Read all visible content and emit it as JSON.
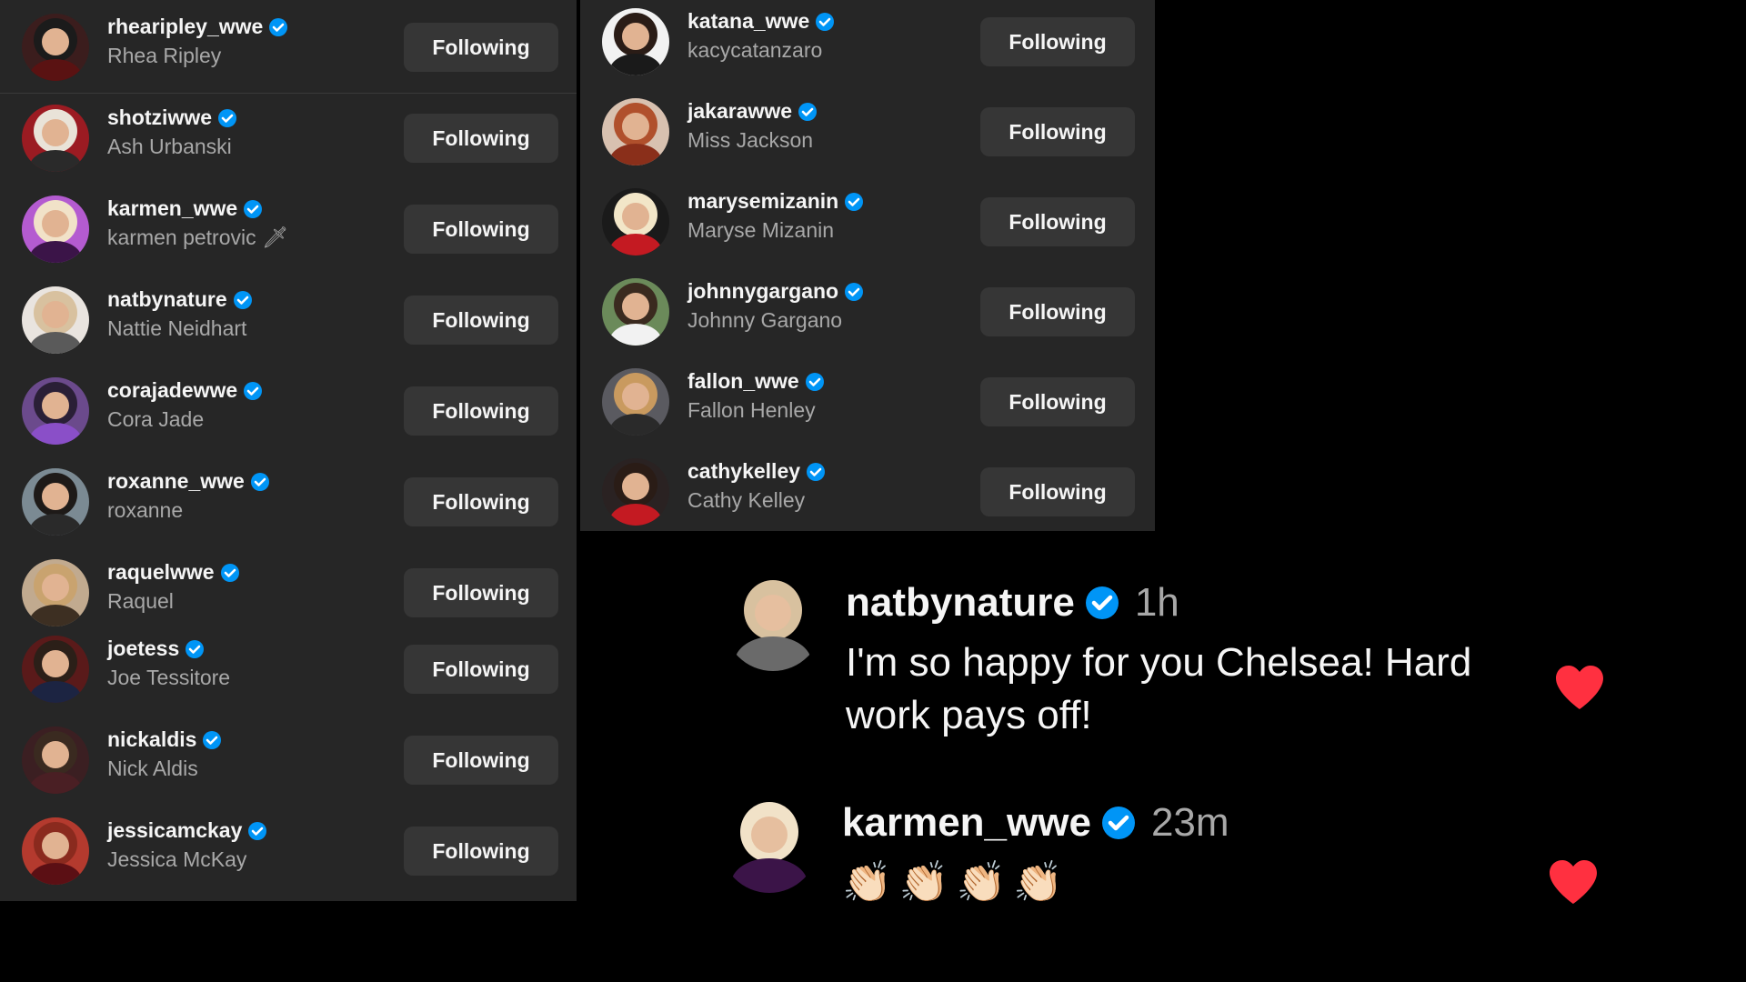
{
  "following_left": [
    {
      "username": "rhearipley_wwe",
      "fullname": "Rhea Ripley",
      "button": "Following",
      "avatar": {
        "hair": "#1b1b1b",
        "bg": "#3b1d1d",
        "body": "#5a1212"
      }
    },
    {
      "username": "shotziwwe",
      "fullname": "Ash Urbanski",
      "button": "Following",
      "avatar": {
        "hair": "#e9e3d8",
        "bg": "#9b1b22",
        "body": "#2a2a2a"
      }
    },
    {
      "username": "karmen_wwe",
      "fullname": "karmen petrovic 🗡",
      "button": "Following",
      "avatar": {
        "hair": "#f1e2c8",
        "bg": "#b45bd0",
        "body": "#3b1448"
      }
    },
    {
      "username": "natbynature",
      "fullname": "Nattie Neidhart",
      "button": "Following",
      "avatar": {
        "hair": "#d8c19f",
        "bg": "#e9e4df",
        "body": "#5a5a5a"
      }
    },
    {
      "username": "corajadewwe",
      "fullname": "Cora Jade",
      "button": "Following",
      "avatar": {
        "hair": "#2a1f36",
        "bg": "#6b4a8c",
        "body": "#8a4fc8"
      }
    },
    {
      "username": "roxanne_wwe",
      "fullname": "roxanne",
      "button": "Following",
      "avatar": {
        "hair": "#1e1a18",
        "bg": "#7b8a93",
        "body": "#2a2a2a"
      }
    },
    {
      "username": "raquelwwe",
      "fullname": "Raquel",
      "button": "Following",
      "avatar": {
        "hair": "#c9a36f",
        "bg": "#c1aa8f",
        "body": "#3d2f22"
      }
    },
    {
      "username": "joetess",
      "fullname": "Joe Tessitore",
      "button": "Following",
      "avatar": {
        "hair": "#2b1f18",
        "bg": "#5a1a1a",
        "body": "#1c2442"
      }
    },
    {
      "username": "nickaldis",
      "fullname": "Nick Aldis",
      "button": "Following",
      "avatar": {
        "hair": "#3a2a20",
        "bg": "#3b1f22",
        "body": "#4a1f24"
      }
    },
    {
      "username": "jessicamckay",
      "fullname": "Jessica McKay",
      "button": "Following",
      "avatar": {
        "hair": "#8a2a1e",
        "bg": "#b43a2e",
        "body": "#5b0f14"
      }
    }
  ],
  "following_right": [
    {
      "username": "katana_wwe",
      "fullname": "kacycatanzaro",
      "button": "Following",
      "avatar": {
        "hair": "#2a1c16",
        "bg": "#f2f2f2",
        "body": "#1a1a1a"
      }
    },
    {
      "username": "jakarawwe",
      "fullname": "Miss Jackson",
      "button": "Following",
      "avatar": {
        "hair": "#b0502c",
        "bg": "#d8c1b0",
        "body": "#8a2f1a"
      }
    },
    {
      "username": "marysemizanin",
      "fullname": "Maryse Mizanin",
      "button": "Following",
      "avatar": {
        "hair": "#f2e6c8",
        "bg": "#1a1a1a",
        "body": "#c41a22"
      }
    },
    {
      "username": "johnnygargano",
      "fullname": "Johnny Gargano",
      "button": "Following",
      "avatar": {
        "hair": "#3a2a1f",
        "bg": "#6b8a5a",
        "body": "#f2f2f2"
      }
    },
    {
      "username": "fallon_wwe",
      "fullname": "Fallon Henley",
      "button": "Following",
      "avatar": {
        "hair": "#c99a5f",
        "bg": "#5a5a60",
        "body": "#2a2a2a"
      }
    },
    {
      "username": "cathykelley",
      "fullname": "Cathy Kelley",
      "button": "Following",
      "avatar": {
        "hair": "#2a1c16",
        "bg": "#2a2222",
        "body": "#c41a22"
      }
    }
  ],
  "comments": [
    {
      "username": "natbynature",
      "time": "1h",
      "text_line1": "I'm so happy for you Chelsea! Hard",
      "text_line2": "work pays off!",
      "avatar": {
        "hair": "#d8c19f",
        "bg": "#e9e4df",
        "body": "#6a6a6a"
      }
    },
    {
      "username": "karmen_wwe",
      "time": "23m",
      "claps": [
        "👏🏻",
        "👏🏻",
        "👏🏻",
        "👏🏻"
      ],
      "avatar": {
        "hair": "#f1e2c8",
        "bg": "#b45bd0",
        "body": "#3b1448"
      }
    }
  ],
  "colors": {
    "verified": "#0095f6",
    "heart": "#ff3040",
    "panel": "#262626",
    "button": "#363636"
  }
}
